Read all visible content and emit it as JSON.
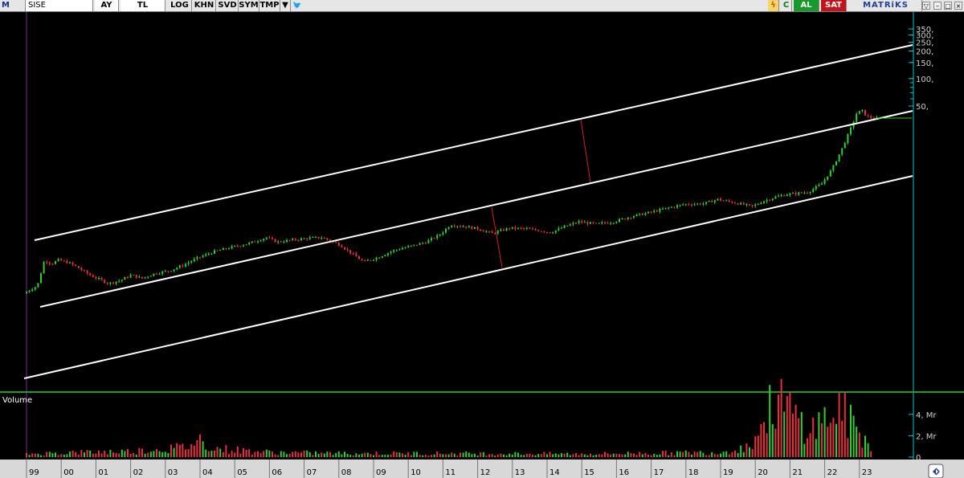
{
  "toolbar": {
    "logo": "M",
    "symbol": "SISE",
    "period": "AY",
    "currency": "TL",
    "log": "LOG",
    "khn": "KHN",
    "svd": "SVD",
    "sym": "SYM",
    "tmp": "TMP",
    "al": "AL",
    "sat": "SAT",
    "c_label": "C",
    "brand": "MATRiKS"
  },
  "colors": {
    "up": "#2fcf2f",
    "down": "#e8303a",
    "channel": "#ffffff",
    "axis": "#00c8c8",
    "background": "#000000",
    "al": "#179a2b",
    "sat": "#c3141b"
  },
  "chart_data": [
    {
      "type": "candlestick",
      "title": "",
      "scale": "log",
      "y_ticks": [
        "350,",
        "300,",
        "250,",
        "200,",
        "150,",
        "100,",
        "50,"
      ],
      "y_tick_values": [
        350,
        300,
        250,
        200,
        150,
        100,
        50
      ],
      "x_ticks": [
        "99",
        "00",
        "01",
        "02",
        "03",
        "04",
        "05",
        "06",
        "07",
        "08",
        "09",
        "10",
        "11",
        "12",
        "13",
        "14",
        "15",
        "16",
        "17",
        "18",
        "19",
        "20",
        "21",
        "22",
        "23"
      ],
      "grid": false,
      "price_anchors": [
        [
          1999.0,
          0.45
        ],
        [
          1999.4,
          0.55
        ],
        [
          1999.6,
          1.05
        ],
        [
          1999.8,
          0.95
        ],
        [
          2000.0,
          1.05
        ],
        [
          2000.3,
          0.98
        ],
        [
          2000.6,
          0.85
        ],
        [
          2000.9,
          0.72
        ],
        [
          2001.2,
          0.64
        ],
        [
          2001.45,
          0.58
        ],
        [
          2001.8,
          0.63
        ],
        [
          2002.1,
          0.72
        ],
        [
          2002.4,
          0.66
        ],
        [
          2002.8,
          0.75
        ],
        [
          2003.2,
          0.8
        ],
        [
          2003.6,
          0.92
        ],
        [
          2004.0,
          1.1
        ],
        [
          2004.5,
          1.3
        ],
        [
          2005.0,
          1.45
        ],
        [
          2005.5,
          1.6
        ],
        [
          2006.0,
          1.85
        ],
        [
          2006.3,
          1.65
        ],
        [
          2006.8,
          1.75
        ],
        [
          2007.2,
          1.82
        ],
        [
          2007.6,
          1.85
        ],
        [
          2008.1,
          1.55
        ],
        [
          2008.5,
          1.2
        ],
        [
          2008.8,
          1.0
        ],
        [
          2009.2,
          1.12
        ],
        [
          2009.7,
          1.35
        ],
        [
          2010.2,
          1.5
        ],
        [
          2010.6,
          1.65
        ],
        [
          2011.0,
          2.0
        ],
        [
          2011.3,
          2.55
        ],
        [
          2011.7,
          2.45
        ],
        [
          2012.1,
          2.3
        ],
        [
          2012.5,
          2.05
        ],
        [
          2013.0,
          2.35
        ],
        [
          2013.5,
          2.3
        ],
        [
          2013.9,
          2.2
        ],
        [
          2014.2,
          2.1
        ],
        [
          2014.6,
          2.45
        ],
        [
          2015.0,
          2.75
        ],
        [
          2015.5,
          2.6
        ],
        [
          2016.0,
          2.75
        ],
        [
          2016.5,
          3.15
        ],
        [
          2017.0,
          3.45
        ],
        [
          2017.5,
          3.85
        ],
        [
          2018.0,
          4.25
        ],
        [
          2018.6,
          4.35
        ],
        [
          2019.0,
          4.85
        ],
        [
          2019.5,
          4.45
        ],
        [
          2020.0,
          4.05
        ],
        [
          2020.3,
          4.6
        ],
        [
          2020.7,
          5.2
        ],
        [
          2021.0,
          5.5
        ],
        [
          2021.6,
          5.8
        ],
        [
          2022.0,
          7.2
        ],
        [
          2022.3,
          10.5
        ],
        [
          2022.6,
          18.0
        ],
        [
          2022.85,
          30.0
        ],
        [
          2023.0,
          42.0
        ],
        [
          2023.15,
          46.0
        ],
        [
          2023.3,
          39.0
        ],
        [
          2023.5,
          37.5
        ]
      ]
    },
    {
      "type": "bar",
      "title": "Volume",
      "y_ticks": [
        "4, Mr",
        "2, Mr",
        "0"
      ],
      "y_tick_values": [
        4,
        2,
        0
      ],
      "units": "Mr",
      "volume_anchors": [
        [
          1999.0,
          0.3
        ],
        [
          2000.5,
          0.45
        ],
        [
          2002.0,
          0.55
        ],
        [
          2003.5,
          0.9
        ],
        [
          2004.0,
          1.6
        ],
        [
          2004.5,
          0.8
        ],
        [
          2006.0,
          0.45
        ],
        [
          2008.0,
          0.35
        ],
        [
          2011.0,
          0.35
        ],
        [
          2015.0,
          0.3
        ],
        [
          2019.0,
          0.45
        ],
        [
          2019.8,
          1.0
        ],
        [
          2020.3,
          3.5
        ],
        [
          2020.6,
          5.6
        ],
        [
          2021.0,
          4.2
        ],
        [
          2021.6,
          2.6
        ],
        [
          2022.0,
          3.5
        ],
        [
          2022.4,
          4.6
        ],
        [
          2023.0,
          2.2
        ],
        [
          2023.4,
          0.9
        ]
      ]
    }
  ]
}
